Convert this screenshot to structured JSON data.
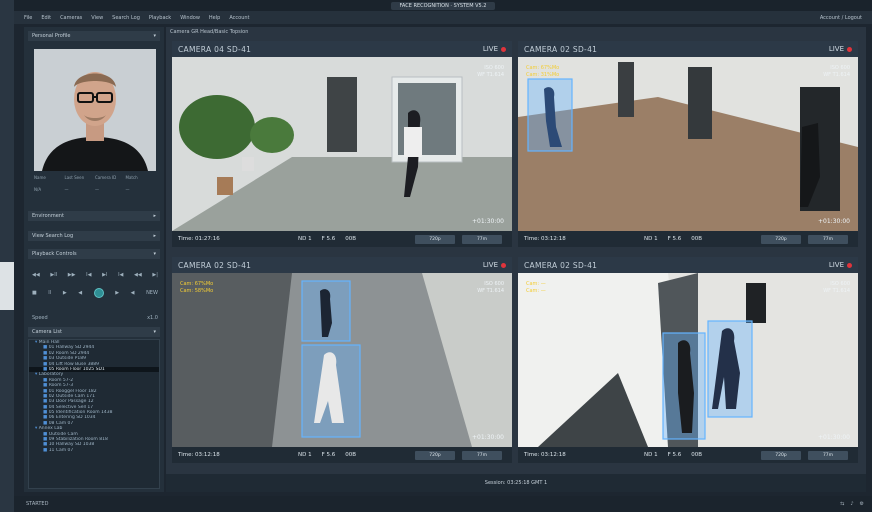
{
  "window": {
    "title": "FACE RECOGNITION · SYSTEM V5.2"
  },
  "menu": {
    "items": [
      "File",
      "Edit",
      "Cameras",
      "View",
      "Search Log",
      "Playback",
      "Window",
      "Help",
      "Account"
    ],
    "account": "Account / Logout"
  },
  "sidebar": {
    "profile_header": "Personal Profile",
    "profile_meta": [
      "Name",
      "Last Seen",
      "Camera ID",
      "Match",
      "N/A",
      "—",
      "—",
      "—"
    ],
    "sections": [
      "Environment",
      "View Search Log",
      "Playback Controls"
    ],
    "playback_rows": [
      [
        "◀◀",
        "▶II",
        "▶▶",
        "I◀",
        "▶I",
        "I◀",
        "◀◀",
        "▶|"
      ],
      [
        "■",
        "II",
        "▶",
        "◀",
        "●",
        "▶",
        "◀",
        "NEW"
      ]
    ],
    "speed_label": "Speed",
    "speed_value": "x1.0",
    "camera_list_header": "Camera List",
    "tree": [
      {
        "text": "Main Hall",
        "lvl": 1,
        "sel": false
      },
      {
        "text": "01 Hallway SD 2944",
        "lvl": 2,
        "sel": false
      },
      {
        "text": "02 Room SD 2944",
        "lvl": 2,
        "sel": false
      },
      {
        "text": "03 Outside P189",
        "lvl": 2,
        "sel": false
      },
      {
        "text": "04 Lift Row Buse 3889",
        "lvl": 2,
        "sel": false
      },
      {
        "text": "05 Room Floor 1025 SD1",
        "lvl": 2,
        "sel": true
      },
      {
        "text": "Laboratory",
        "lvl": 1,
        "sel": false
      },
      {
        "text": "Room 57-2",
        "lvl": 2,
        "sel": false
      },
      {
        "text": "Room 57-3",
        "lvl": 2,
        "sel": false
      },
      {
        "text": "01 Rooggel Floor 182",
        "lvl": 2,
        "sel": false
      },
      {
        "text": "02 Outside Cam 171",
        "lvl": 2,
        "sel": false
      },
      {
        "text": "03 Door Passage 12",
        "lvl": 2,
        "sel": false
      },
      {
        "text": "04 Selective Sell 17",
        "lvl": 2,
        "sel": false
      },
      {
        "text": "05 Identification Room 1438",
        "lvl": 2,
        "sel": false
      },
      {
        "text": "06 Entering SD 1034",
        "lvl": 2,
        "sel": false
      },
      {
        "text": "08 Cam 07",
        "lvl": 2,
        "sel": false
      },
      {
        "text": "Annex Lab",
        "lvl": 1,
        "sel": false
      },
      {
        "text": "Outside Cam",
        "lvl": 2,
        "sel": false
      },
      {
        "text": "09 Stabilization Room 818",
        "lvl": 2,
        "sel": false
      },
      {
        "text": "10 Hallway SD 1038",
        "lvl": 2,
        "sel": false
      },
      {
        "text": "11 Cam 07",
        "lvl": 2,
        "sel": false
      }
    ]
  },
  "main": {
    "tab": "Camera GR Head/Basic Topsion",
    "bottom_status": "Session: 03:25:18 GMT 1",
    "cameras": [
      {
        "name": "CAMERA 04 SD-41",
        "live": "LIVE",
        "iso": "ISO 600",
        "wb": "WF T1.614",
        "cam_lines": [],
        "time": "Time: 01:27:16",
        "meta": [
          "ND 1",
          "F 5.6",
          "00B"
        ],
        "btn1": "720p",
        "btn2": "77m",
        "ts": "+01:30:00"
      },
      {
        "name": "CAMERA 02 SD-41",
        "live": "LIVE",
        "iso": "ISO 600",
        "wb": "WF T1.614",
        "cam_lines": [
          "Cam: 67%Mo",
          "Cam: 31%Mo"
        ],
        "time": "Time: 03:12:18",
        "meta": [
          "ND 1",
          "F 5.6",
          "00B"
        ],
        "btn1": "720p",
        "btn2": "77m",
        "ts": "+01:30:00"
      },
      {
        "name": "CAMERA 02 SD-41",
        "live": "LIVE",
        "iso": "ISO 600",
        "wb": "WF T1.614",
        "cam_lines": [
          "Cam: 67%Mo",
          "Cam: 58%Mo"
        ],
        "time": "Time: 03:12:18",
        "meta": [
          "ND 1",
          "F 5.6",
          "00B"
        ],
        "btn1": "720p",
        "btn2": "77m",
        "ts": "+01:30:00"
      },
      {
        "name": "CAMERA 02 SD-41",
        "live": "LIVE",
        "iso": "ISO 600",
        "wb": "WF T1.614",
        "cam_lines": [
          "Cam: —",
          "Cam: —"
        ],
        "time": "Time: 03:12:18",
        "meta": [
          "ND 1",
          "F 5.6",
          "00B"
        ],
        "btn1": "720p",
        "btn2": "77m",
        "ts": "+01:30:00"
      }
    ]
  },
  "statusbar": {
    "text": "STARTED"
  },
  "colors": {
    "live_dot": "#e0343c",
    "detect_box": "#64b4ff",
    "accent_yellow": "#f3cd35",
    "jog": "#2f8f95"
  }
}
